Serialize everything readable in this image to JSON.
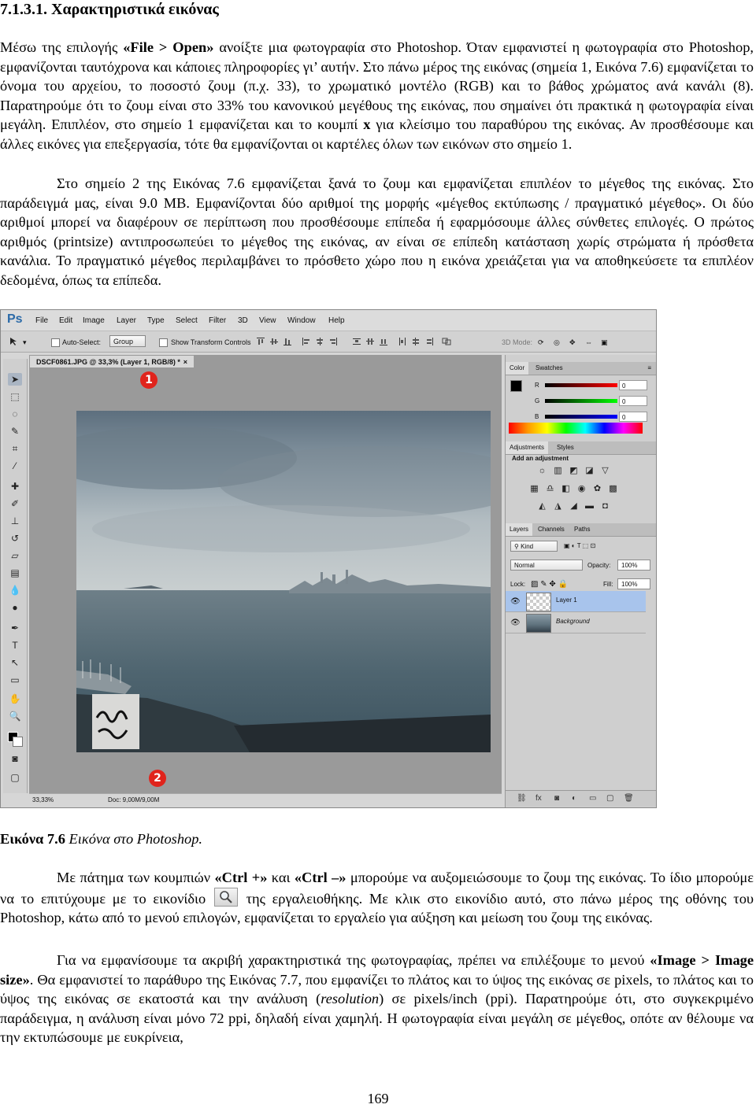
{
  "heading": "7.1.3.1. Χαρακτηριστικά εικόνας",
  "intro": {
    "s1_pre": "Μέσω της επιλογής ",
    "s1_bold": "«File > Open»",
    "s1_post": " ανοίξτε μια φωτογραφία στο Photoshop. Όταν εμφανιστεί η φωτογραφία στο Photoshop, εμφανίζονται ταυτόχρονα και κάποιες πληροφορίες γι’ αυτήν. Στο πάνω μέρος της εικόνας (σημεία 1, Εικόνα 7.6) εμφανίζεται το όνομα του αρχείου, το ποσοστό ζουμ (π.χ. 33), το χρωματικό μοντέλο (RGB) και το βάθος χρώματος ανά κανάλι (8). Παρατηρούμε ότι το ζουμ είναι στο 33% του κανονικού μεγέθους της εικόνας, που σημαίνει ότι πρακτικά η φωτογραφία είναι μεγάλη. Επιπλέον, στο σημείο 1 εμφανίζεται και το κουμπί ",
    "s1_x": "x",
    "s1_end": " για κλείσιμο του παραθύρου της εικόνας. Αν προσθέσουμε και άλλες εικόνες για επεξεργασία, τότε θα εμφανίζονται οι καρτέλες όλων των εικόνων στο σημείο 1.",
    "p2": "Στο σημείο 2 της Εικόνας 7.6 εμφανίζεται ξανά το ζουμ και εμφανίζεται επιπλέον το μέγεθος της εικόνας. Στο παράδειγμά μας, είναι 9.0 MB. Εμφανίζονται δύο αριθμοί της μορφής «μέγεθος εκτύπωσης / πραγματικό μέγεθος». Οι δύο αριθμοί μπορεί να διαφέρουν σε περίπτωση που προσθέσουμε επίπεδα ή εφαρμόσουμε άλλες σύνθετες επιλογές. Ο πρώτος αριθμός (printsize) αντιπροσωπεύει το μέγεθος της εικόνας, αν είναι σε επίπεδη κατάσταση χωρίς στρώματα ή πρόσθετα κανάλια. Το πραγματικό μέγεθος περιλαμβάνει το πρόσθετο χώρο που η εικόνα χρειάζεται για να αποθηκεύσετε τα επιπλέον δεδομένα, όπως τα επίπεδα."
  },
  "screenshot": {
    "app_logo": "Ps",
    "menu": [
      "File",
      "Edit",
      "Image",
      "Layer",
      "Type",
      "Select",
      "Filter",
      "3D",
      "View",
      "Window",
      "Help"
    ],
    "options": {
      "auto_select": "Auto-Select:",
      "group": "Group",
      "show_transform": "Show Transform Controls",
      "mode_3d": "3D Mode:"
    },
    "doc_tab": "DSCF0861.JPG @ 33,3% (Layer 1, RGB/8) *",
    "doc_close": "×",
    "marker1": "1",
    "marker2": "2",
    "status_zoom": "33,33%",
    "status_doc": "Doc: 9,00M/9,00M",
    "color_panel": {
      "tabs": [
        "Color",
        "Swatches"
      ],
      "r_label": "R",
      "g_label": "G",
      "b_label": "B",
      "r_value": "0",
      "g_value": "0",
      "b_value": "0"
    },
    "adjustments_panel": {
      "tabs": [
        "Adjustments",
        "Styles"
      ],
      "title": "Add an adjustment"
    },
    "layers_panel": {
      "tabs": [
        "Layers",
        "Channels",
        "Paths"
      ],
      "kind": "Kind",
      "blend_mode": "Normal",
      "opacity_label": "Opacity:",
      "opacity_value": "100%",
      "lock_label": "Lock:",
      "fill_label": "Fill:",
      "fill_value": "100%",
      "layers": [
        "Layer 1",
        "Background"
      ]
    }
  },
  "caption": {
    "label": "Εικόνα 7.6",
    "text": " Εικόνα στο Photoshop."
  },
  "after": {
    "p3_pre": "Με πάτημα των κουμπιών ",
    "p3_b1": "«Ctrl +»",
    "p3_mid": " και ",
    "p3_b2": "«Ctrl –»",
    "p3_post": " μπορούμε να αυξομειώσουμε το ζουμ της εικόνας. Το ίδιο μπορούμε να το επιτύχουμε με το εικονίδιο ",
    "p3_end": " της εργαλειοθήκης. Με κλικ στο εικονίδιο αυτό, στο πάνω μέρος της οθόνης του Photoshop, κάτω από το μενού επιλογών, εμφανίζεται το εργαλείο για αύξηση και μείωση του ζουμ της εικόνας.",
    "p4_pre": "Για να εμφανίσουμε τα ακριβή χαρακτηριστικά της φωτογραφίας, πρέπει να επιλέξουμε το μενού ",
    "p4_bold": "«Image > Image size»",
    "p4_mid": ". Θα εμφανιστεί το παράθυρο της Εικόνας 7.7, που εμφανίζει το πλάτος και το ύψος της εικόνας σε pixels, το πλάτος και το ύψος της εικόνας σε εκατοστά και την ανάλυση (",
    "p4_ital": "resolution",
    "p4_end": ") σε pixels/inch (ppi). Παρατηρούμε ότι, στο συγκεκριμένο παράδειγμα, η ανάλυση είναι μόνο 72 ppi, δηλαδή είναι χαμηλή. Η φωτογραφία είναι μεγάλη σε μέγεθος, οπότε αν θέλουμε να την εκτυπώσουμε με ευκρίνεια,"
  },
  "page_number": "169"
}
